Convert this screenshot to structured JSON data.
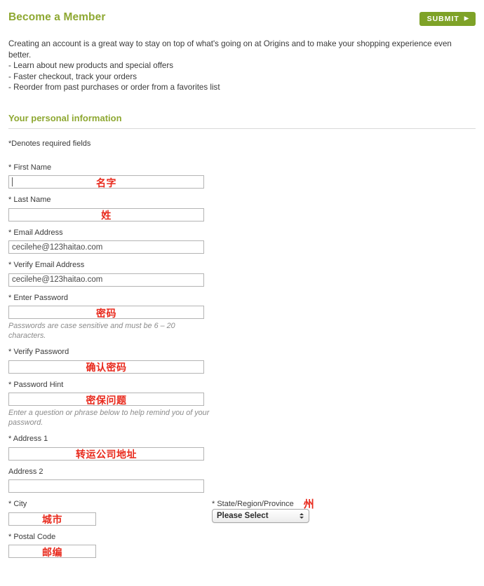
{
  "header": {
    "title": "Become a Member",
    "submit_label": "SUBMIT",
    "submit_arrow": "▶",
    "accent_color": "#8ea832",
    "button_color": "#7ea227"
  },
  "intro": {
    "paragraph": "Creating an account is a great way to stay on top of what's going on at Origins and to make your shopping experience even better.",
    "bullets": [
      "- Learn about new products and special offers",
      "- Faster checkout, track your orders",
      "- Reorder from past purchases or order from a favorites list"
    ]
  },
  "section": {
    "heading": "Your personal information",
    "denotes": "*Denotes required fields"
  },
  "annotation_color": "#e8291c",
  "fields": {
    "first_name": {
      "label": "* First Name",
      "value": "",
      "annotation": "名字"
    },
    "last_name": {
      "label": "* Last Name",
      "value": "",
      "annotation": "姓"
    },
    "email": {
      "label": "* Email Address",
      "value": "cecilehe@123haitao.com",
      "annotation": ""
    },
    "verify_email": {
      "label": "* Verify Email Address",
      "value": "cecilehe@123haitao.com",
      "annotation": ""
    },
    "password": {
      "label": "* Enter Password",
      "value": "",
      "annotation": "密码",
      "hint": "Passwords are case sensitive and must be 6 – 20 characters."
    },
    "verify_password": {
      "label": "* Verify Password",
      "value": "",
      "annotation": "确认密码"
    },
    "password_hint": {
      "label": "* Password Hint",
      "value": "",
      "annotation": "密保问题",
      "hint": "Enter a question or phrase below to help remind you of your password."
    },
    "address1": {
      "label": "* Address 1",
      "value": "",
      "annotation": "转运公司地址"
    },
    "address2": {
      "label": "Address 2",
      "value": "",
      "annotation": ""
    },
    "city": {
      "label": "* City",
      "value": "",
      "annotation": "城市"
    },
    "state": {
      "label": "* State/Region/Province",
      "value": "Please Select",
      "annotation": "州"
    },
    "postal_code": {
      "label": "* Postal Code",
      "value": "",
      "annotation": "邮编"
    }
  }
}
